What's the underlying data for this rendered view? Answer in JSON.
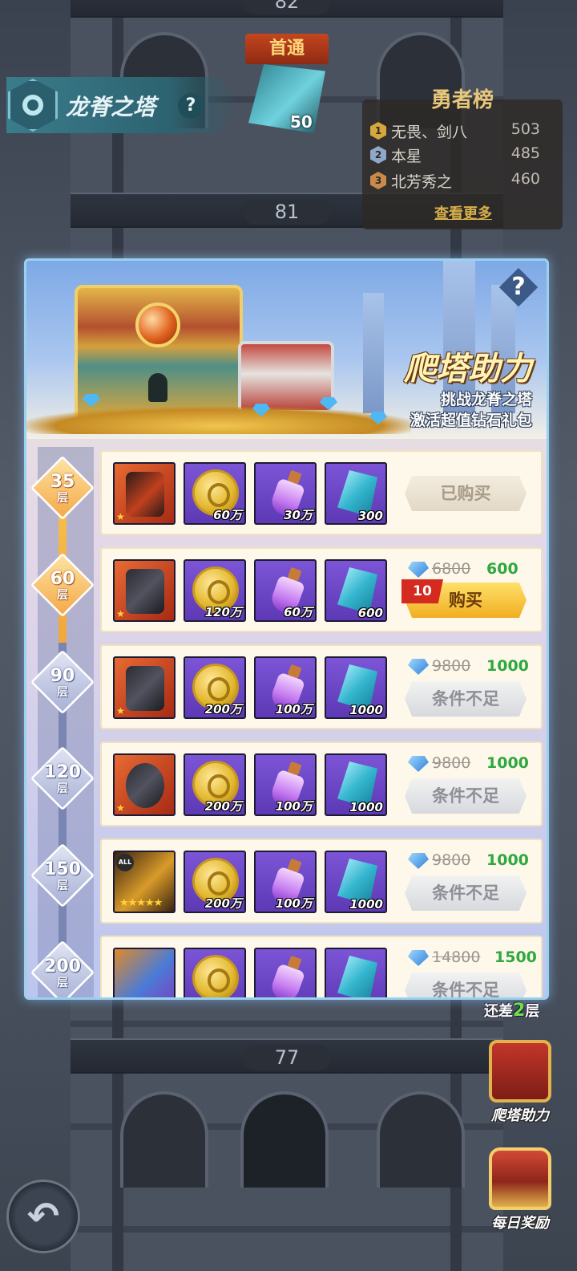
{
  "tower": {
    "name": "龙脊之塔",
    "help": "?",
    "floors": {
      "top": "82",
      "mid": "81",
      "bottom": "77"
    },
    "first_clear": {
      "label": "首通",
      "count": "50"
    }
  },
  "hero_board": {
    "title": "勇者榜",
    "entries": [
      {
        "rank": "1",
        "name": "无畏、剑八",
        "score": "503",
        "color": "#d4a83c"
      },
      {
        "rank": "2",
        "name": "本星",
        "score": "485",
        "color": "#8fa8c8"
      },
      {
        "rank": "3",
        "name": "北芳秀之",
        "score": "460",
        "color": "#c98a4a"
      }
    ],
    "see_more": "查看更多"
  },
  "modal": {
    "help": "?",
    "title": "爬塔助力",
    "subtitle_1": "挑战龙脊之塔",
    "subtitle_2": "激活超值钻石礼包",
    "tiers": [
      {
        "floor": "35",
        "unit": "层",
        "state": "active"
      },
      {
        "floor": "60",
        "unit": "层",
        "state": "active"
      },
      {
        "floor": "90",
        "unit": "层",
        "state": "locked"
      },
      {
        "floor": "120",
        "unit": "层",
        "state": "locked"
      },
      {
        "floor": "150",
        "unit": "层",
        "state": "locked"
      },
      {
        "floor": "200",
        "unit": "层",
        "state": "locked"
      }
    ],
    "packs": [
      {
        "equip": "weapon-icon",
        "gold": "60万",
        "potion": "30万",
        "crystal": "300",
        "old_price": "",
        "new_price": "",
        "discount": "",
        "button": "已购买",
        "button_state": "bought"
      },
      {
        "equip": "armor-icon",
        "gold": "120万",
        "potion": "60万",
        "crystal": "600",
        "old_price": "6800",
        "new_price": "600",
        "discount": "10",
        "button": "购买",
        "button_state": "buy"
      },
      {
        "equip": "boots-icon",
        "gold": "200万",
        "potion": "100万",
        "crystal": "1000",
        "old_price": "9800",
        "new_price": "1000",
        "discount": "",
        "button": "条件不足",
        "button_state": "disabled"
      },
      {
        "equip": "ring-icon",
        "gold": "200万",
        "potion": "100万",
        "crystal": "1000",
        "old_price": "9800",
        "new_price": "1000",
        "discount": "",
        "button": "条件不足",
        "button_state": "disabled"
      },
      {
        "equip": "helmet-icon",
        "gold": "200万",
        "potion": "100万",
        "crystal": "1000",
        "old_price": "9800",
        "new_price": "1000",
        "discount": "",
        "button": "条件不足",
        "button_state": "disabled",
        "all_badge": "ALL",
        "stars": "★★★★★"
      },
      {
        "equip": "gem-chest-icon",
        "gold": "",
        "potion": "",
        "crystal": "",
        "old_price": "14800",
        "new_price": "1500",
        "discount": "",
        "button": "条件不足",
        "button_state": "disabled"
      }
    ]
  },
  "side": {
    "remain_prefix": "还差",
    "remain_value": "2",
    "remain_suffix": "层",
    "climb_help": "爬塔助力",
    "daily_reward": "每日奖励"
  },
  "back": "↶"
}
